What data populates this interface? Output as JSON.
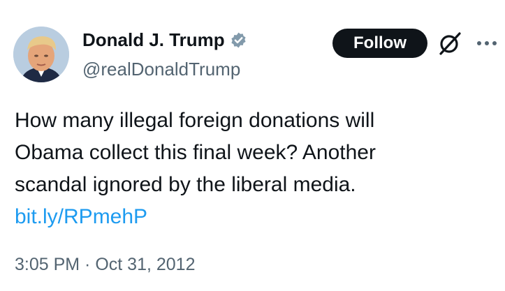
{
  "author": {
    "display_name": "Donald J. Trump",
    "handle": "@realDonaldTrump",
    "verified": true
  },
  "actions": {
    "follow_label": "Follow"
  },
  "icons": {
    "verified": "verified-badge-icon",
    "grok": "grok-icon",
    "more": "more-options-icon"
  },
  "tweet": {
    "lines": [
      "How many illegal foreign donations will",
      "Obama collect this final week? Another",
      "scandal ignored by the liberal media."
    ],
    "link": "bit.ly/RPmehP"
  },
  "meta": {
    "time": "3:05 PM",
    "separator": " · ",
    "date": "Oct 31, 2012"
  },
  "colors": {
    "text": "#0f1419",
    "secondary": "#536471",
    "link": "#1d9bf0",
    "follow_bg": "#0f1419",
    "verified": "#829aab"
  }
}
